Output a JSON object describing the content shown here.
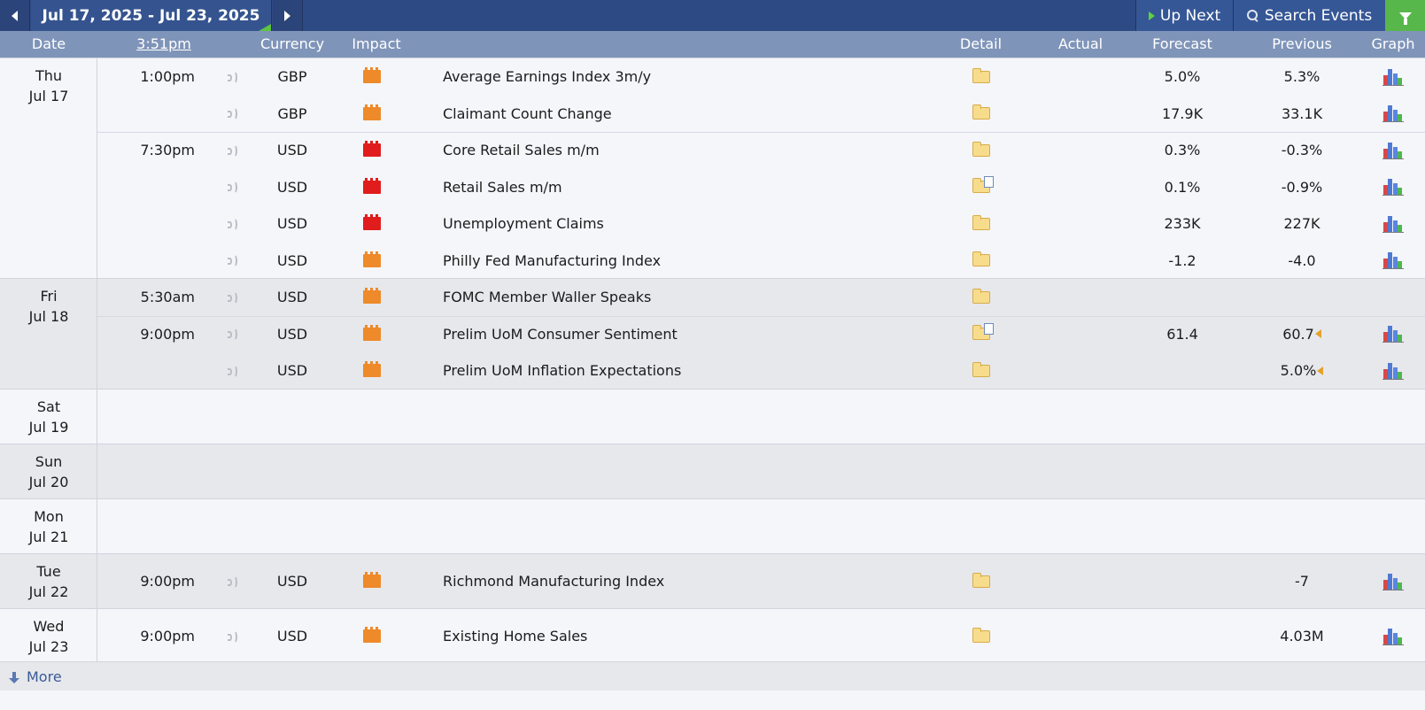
{
  "toolbar": {
    "date_range": "Jul 17, 2025 - Jul 23, 2025",
    "up_next_label": "Up Next",
    "search_label": "Search Events",
    "accent_color": "#57b74a"
  },
  "columns": {
    "date": "Date",
    "time": "3:51pm",
    "currency": "Currency",
    "impact": "Impact",
    "detail": "Detail",
    "actual": "Actual",
    "forecast": "Forecast",
    "previous": "Previous",
    "graph": "Graph"
  },
  "days": [
    {
      "dow": "Thu",
      "date": "Jul 17",
      "shade": "light",
      "rows": 6
    },
    {
      "dow": "Fri",
      "date": "Jul 18",
      "shade": "dark",
      "rows": 3
    },
    {
      "dow": "Sat",
      "date": "Jul 19",
      "shade": "light",
      "rows": 0
    },
    {
      "dow": "Sun",
      "date": "Jul 20",
      "shade": "dark",
      "rows": 0
    },
    {
      "dow": "Mon",
      "date": "Jul 21",
      "shade": "light",
      "rows": 0
    },
    {
      "dow": "Tue",
      "date": "Jul 22",
      "shade": "dark",
      "rows": 1
    },
    {
      "dow": "Wed",
      "date": "Jul 23",
      "shade": "light",
      "rows": 1
    }
  ],
  "events": [
    {
      "time": "1:00pm",
      "currency": "GBP",
      "impact": "orange",
      "event": "Average Earnings Index 3m/y",
      "detail": "folder",
      "actual": "",
      "forecast": "5.0%",
      "previous": "5.3%",
      "revised": false,
      "graph": true
    },
    {
      "time": "",
      "currency": "GBP",
      "impact": "orange",
      "event": "Claimant Count Change",
      "detail": "folder",
      "actual": "",
      "forecast": "17.9K",
      "previous": "33.1K",
      "revised": false,
      "graph": true
    },
    {
      "time": "7:30pm",
      "currency": "USD",
      "impact": "red",
      "event": "Core Retail Sales m/m",
      "detail": "folder",
      "actual": "",
      "forecast": "0.3%",
      "previous": "-0.3%",
      "revised": false,
      "graph": true
    },
    {
      "time": "",
      "currency": "USD",
      "impact": "red",
      "event": "Retail Sales m/m",
      "detail": "folder-doc",
      "actual": "",
      "forecast": "0.1%",
      "previous": "-0.9%",
      "revised": false,
      "graph": true
    },
    {
      "time": "",
      "currency": "USD",
      "impact": "red",
      "event": "Unemployment Claims",
      "detail": "folder",
      "actual": "",
      "forecast": "233K",
      "previous": "227K",
      "revised": false,
      "graph": true
    },
    {
      "time": "",
      "currency": "USD",
      "impact": "orange",
      "event": "Philly Fed Manufacturing Index",
      "detail": "folder",
      "actual": "",
      "forecast": "-1.2",
      "previous": "-4.0",
      "revised": false,
      "graph": true
    },
    {
      "time": "5:30am",
      "currency": "USD",
      "impact": "orange",
      "event": "FOMC Member Waller Speaks",
      "detail": "folder",
      "actual": "",
      "forecast": "",
      "previous": "",
      "revised": false,
      "graph": false
    },
    {
      "time": "9:00pm",
      "currency": "USD",
      "impact": "orange",
      "event": "Prelim UoM Consumer Sentiment",
      "detail": "folder-doc",
      "actual": "",
      "forecast": "61.4",
      "previous": "60.7",
      "revised": true,
      "graph": true
    },
    {
      "time": "",
      "currency": "USD",
      "impact": "orange",
      "event": "Prelim UoM Inflation Expectations",
      "detail": "folder",
      "actual": "",
      "forecast": "",
      "previous": "5.0%",
      "revised": true,
      "graph": true
    },
    {
      "time": "9:00pm",
      "currency": "USD",
      "impact": "orange",
      "event": "Richmond Manufacturing Index",
      "detail": "folder",
      "actual": "",
      "forecast": "",
      "previous": "-7",
      "revised": false,
      "graph": true
    },
    {
      "time": "9:00pm",
      "currency": "USD",
      "impact": "orange",
      "event": "Existing Home Sales",
      "detail": "folder",
      "actual": "",
      "forecast": "",
      "previous": "4.03M",
      "revised": false,
      "graph": true
    }
  ],
  "footer": {
    "more_label": "More"
  }
}
